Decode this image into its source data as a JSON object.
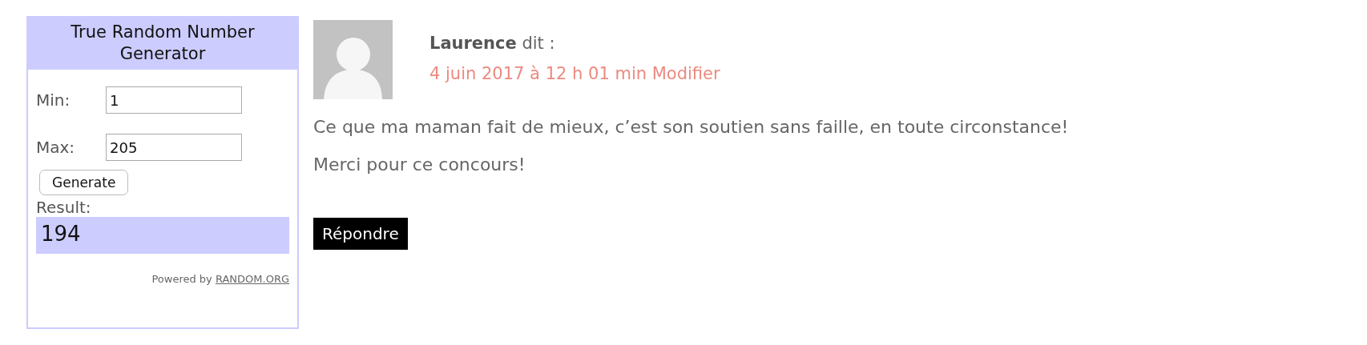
{
  "widget": {
    "title": "True Random Number Generator",
    "min_label": "Min:",
    "min_value": "1",
    "max_label": "Max:",
    "max_value": "205",
    "button": "Generate",
    "result_label": "Result:",
    "result": "194",
    "powered_by": "Powered by",
    "link": "RANDOM.ORG"
  },
  "comment": {
    "author": "Laurence",
    "says": "dit :",
    "date": "4 juin 2017 à 12 h 01 min",
    "edit": "Modifier",
    "paragraphs": [
      "Ce que ma maman fait de mieux, c’est son soutien sans faille, en toute circonstance!",
      "Merci pour ce concours!"
    ],
    "reply": "Répondre"
  }
}
